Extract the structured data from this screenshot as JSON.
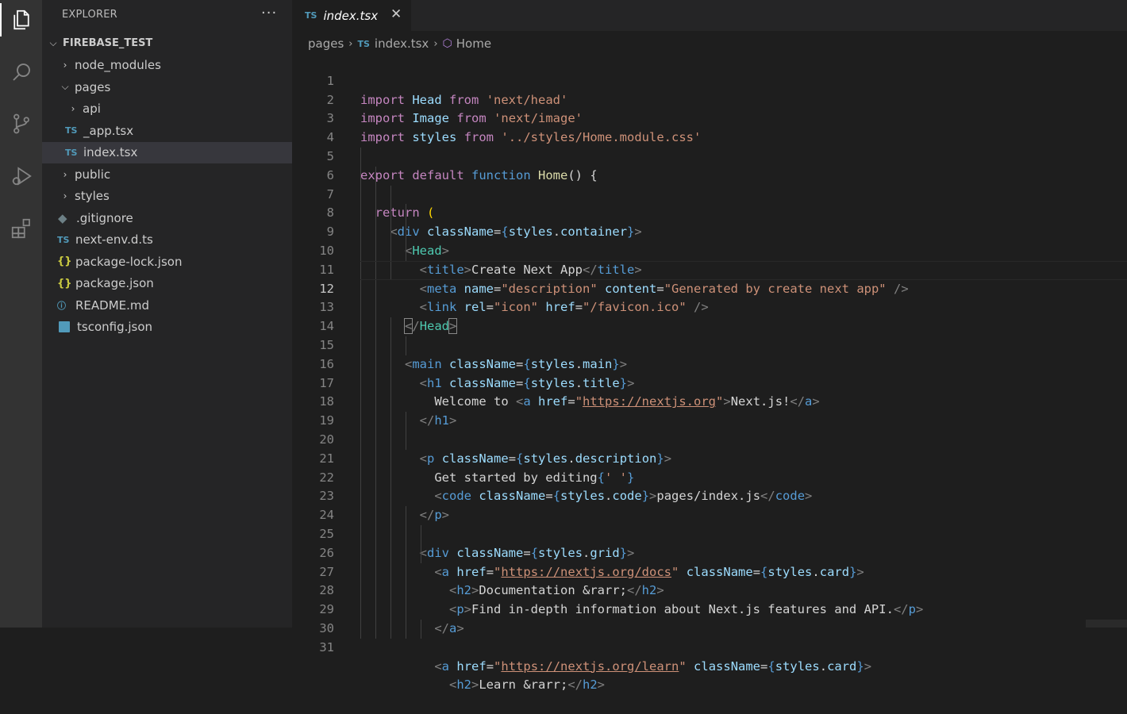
{
  "activity_bar": {
    "items": [
      {
        "name": "explorer-icon",
        "active": true
      },
      {
        "name": "search-icon",
        "active": false
      },
      {
        "name": "source-control-icon",
        "active": false
      },
      {
        "name": "run-debug-icon",
        "active": false
      },
      {
        "name": "extensions-icon",
        "active": false
      }
    ]
  },
  "sidebar": {
    "title": "EXPLORER",
    "more": "···",
    "tree": [
      {
        "label": "FIREBASE_TEST",
        "type": "folder-root",
        "depth": 0,
        "expanded": true
      },
      {
        "label": "node_modules",
        "type": "folder",
        "depth": 1,
        "expanded": false
      },
      {
        "label": "pages",
        "type": "folder",
        "depth": 1,
        "expanded": true
      },
      {
        "label": "api",
        "type": "folder",
        "depth": 2,
        "expanded": false
      },
      {
        "label": "_app.tsx",
        "type": "file",
        "icon": "TS",
        "depth": 2
      },
      {
        "label": "index.tsx",
        "type": "file",
        "icon": "TS",
        "depth": 2,
        "selected": true
      },
      {
        "label": "public",
        "type": "folder",
        "depth": 1,
        "expanded": false
      },
      {
        "label": "styles",
        "type": "folder",
        "depth": 1,
        "expanded": false
      },
      {
        "label": ".gitignore",
        "type": "file",
        "icon": "git",
        "depth": 1
      },
      {
        "label": "next-env.d.ts",
        "type": "file",
        "icon": "TS",
        "depth": 1
      },
      {
        "label": "package-lock.json",
        "type": "file",
        "icon": "{}",
        "depth": 1
      },
      {
        "label": "package.json",
        "type": "file",
        "icon": "{}",
        "depth": 1
      },
      {
        "label": "README.md",
        "type": "file",
        "icon": "info",
        "depth": 1
      },
      {
        "label": "tsconfig.json",
        "type": "file",
        "icon": "tsconfig",
        "depth": 1
      }
    ]
  },
  "editor": {
    "tab": {
      "icon": "TS",
      "label": "index.tsx",
      "close": "✕"
    },
    "breadcrumb": {
      "folder": "pages",
      "file_icon": "TS",
      "file": "index.tsx",
      "symbol": "Home"
    },
    "current_line": 12,
    "lines": [
      {
        "n": "1"
      },
      {
        "n": "2"
      },
      {
        "n": "3"
      },
      {
        "n": "4"
      },
      {
        "n": "5"
      },
      {
        "n": "6"
      },
      {
        "n": "7"
      },
      {
        "n": "8"
      },
      {
        "n": "9"
      },
      {
        "n": "10"
      },
      {
        "n": "11"
      },
      {
        "n": "12"
      },
      {
        "n": "13"
      },
      {
        "n": "14"
      },
      {
        "n": "15"
      },
      {
        "n": "16"
      },
      {
        "n": "17"
      },
      {
        "n": "18"
      },
      {
        "n": "19"
      },
      {
        "n": "20"
      },
      {
        "n": "21"
      },
      {
        "n": "22"
      },
      {
        "n": "23"
      },
      {
        "n": "24"
      },
      {
        "n": "25"
      },
      {
        "n": "26"
      },
      {
        "n": "27"
      },
      {
        "n": "28"
      },
      {
        "n": "29"
      },
      {
        "n": "30"
      },
      {
        "n": "31"
      }
    ],
    "code": {
      "l1": [
        "import",
        "Head",
        "from",
        "'next/head'"
      ],
      "l2": [
        "import",
        "Image",
        "from",
        "'next/image'"
      ],
      "l3": [
        "import",
        "styles",
        "from",
        "'../styles/Home.module.css'"
      ],
      "l5": [
        "export",
        "default",
        "function",
        "Home",
        "() {"
      ],
      "l6": [
        "return",
        "("
      ],
      "l7": [
        "div",
        "className",
        "styles",
        "container"
      ],
      "l8": [
        "Head"
      ],
      "l9": [
        "title",
        "Create Next App",
        "title"
      ],
      "l10": [
        "meta",
        "name",
        "\"description\"",
        "content",
        "\"Generated by create next app\"",
        "/>"
      ],
      "l11": [
        "link",
        "rel",
        "\"icon\"",
        "href",
        "\"/favicon.ico\"",
        "/>"
      ],
      "l12": [
        "Head"
      ],
      "l14": [
        "main",
        "className",
        "styles",
        "main"
      ],
      "l15": [
        "h1",
        "className",
        "styles",
        "title"
      ],
      "l16": [
        "Welcome to ",
        "a",
        "href",
        "https://nextjs.org",
        "Next.js!",
        "a"
      ],
      "l17": [
        "h1"
      ],
      "l19": [
        "p",
        "className",
        "styles",
        "description"
      ],
      "l20": [
        "Get started by editing",
        "' '"
      ],
      "l21": [
        "code",
        "className",
        "styles",
        "code",
        "pages/index.js",
        "code"
      ],
      "l22": [
        "p"
      ],
      "l24": [
        "div",
        "className",
        "styles",
        "grid"
      ],
      "l25": [
        "a",
        "href",
        "https://nextjs.org/docs",
        "className",
        "styles",
        "card"
      ],
      "l26": [
        "h2",
        "Documentation &rarr;",
        "h2"
      ],
      "l27": [
        "p",
        "Find in-depth information about Next.js features and API.",
        "p"
      ],
      "l28": [
        "a"
      ],
      "l30": [
        "a",
        "href",
        "https://nextjs.org/learn",
        "className",
        "styles",
        "card"
      ],
      "l31": [
        "h2",
        "Learn &rarr;",
        "h2"
      ]
    }
  },
  "colors": {
    "activity_bg": "#333333",
    "sidebar_bg": "#252526",
    "editor_bg": "#1e1e1e",
    "ts_icon": "#519aba",
    "json_icon": "#cbcb41",
    "keyword": "#c586c0",
    "string": "#ce9178",
    "variable": "#9cdcfe",
    "tag": "#569cd6",
    "component": "#4ec9b0"
  }
}
